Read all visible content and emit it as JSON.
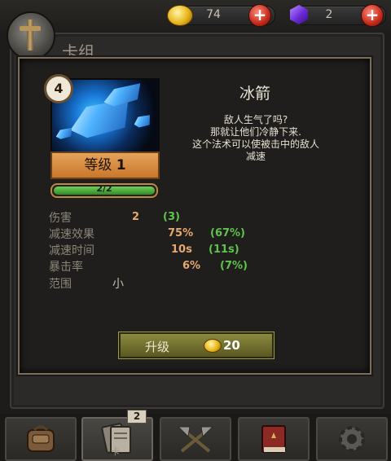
{
  "currency": {
    "gold": "74",
    "gems": "2"
  },
  "window": {
    "title": "卡组"
  },
  "card": {
    "level_badge": "4",
    "name": "冰箭",
    "level_prefix": "等级",
    "level_num": "1",
    "xp_text": "2/2",
    "xp_fraction": 1.0,
    "description": [
      "敌人生气了吗?",
      "那就让他们冷静下来.",
      "这个法术可以使被击中的敌人",
      "减速"
    ]
  },
  "stats": {
    "damage": {
      "label": "伤害",
      "value": "2",
      "next": "(3)"
    },
    "slow_effect": {
      "label": "减速效果",
      "value": "75%",
      "next": "(67%)"
    },
    "slow_time": {
      "label": "减速时间",
      "value": "10s",
      "next": "(11s)"
    },
    "crit": {
      "label": "暴击率",
      "value": "6%",
      "next": "(7%)"
    },
    "range": {
      "label": "范围",
      "value": "小"
    }
  },
  "upgrade": {
    "label": "升级",
    "cost": "20"
  },
  "tabs": {
    "deck_badge": "2",
    "deck_label": "卡"
  },
  "colors": {
    "stat_value": "#e6a870",
    "stat_upgrade": "#5ec44a",
    "upgrade_button": "#7a7832"
  }
}
